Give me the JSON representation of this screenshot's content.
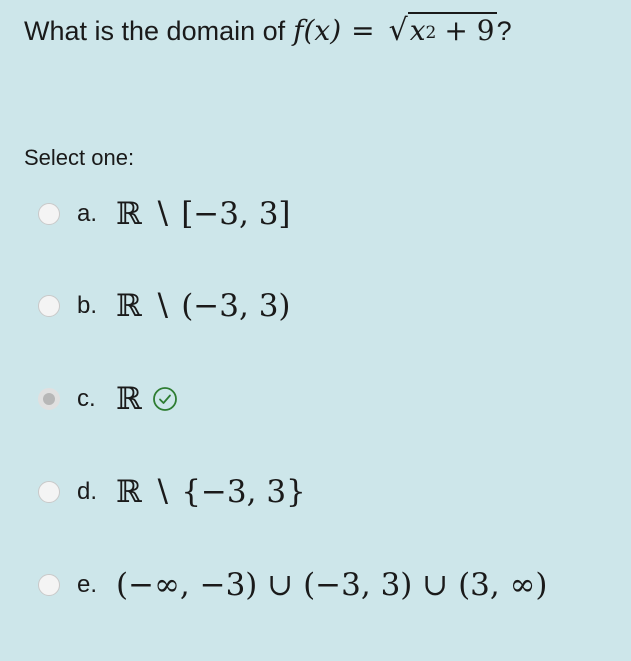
{
  "question": {
    "text": "What is the domain of",
    "math_fx": "f(x)",
    "math_eq": "=",
    "radical": "√",
    "radicand_base": "x",
    "radicand_exp": "2",
    "radicand_rest": "+ 9",
    "qmark": "?"
  },
  "prompt": "Select one:",
  "options": [
    {
      "letter": "a.",
      "math": "ℝ ∖ [−3, 3]",
      "selected": false
    },
    {
      "letter": "b.",
      "math": "ℝ ∖ (−3, 3)",
      "selected": false
    },
    {
      "letter": "c.",
      "math": "ℝ",
      "selected": true,
      "correct_icon": "check-circle-icon"
    },
    {
      "letter": "d.",
      "math": "ℝ ∖ {−3, 3}",
      "selected": false
    },
    {
      "letter": "e.",
      "math": "(−∞, −3) ∪ (−3, 3) ∪ (3, ∞)",
      "selected": false
    }
  ],
  "colors": {
    "background": "#cde6ea",
    "correct": "#2e7d32"
  }
}
